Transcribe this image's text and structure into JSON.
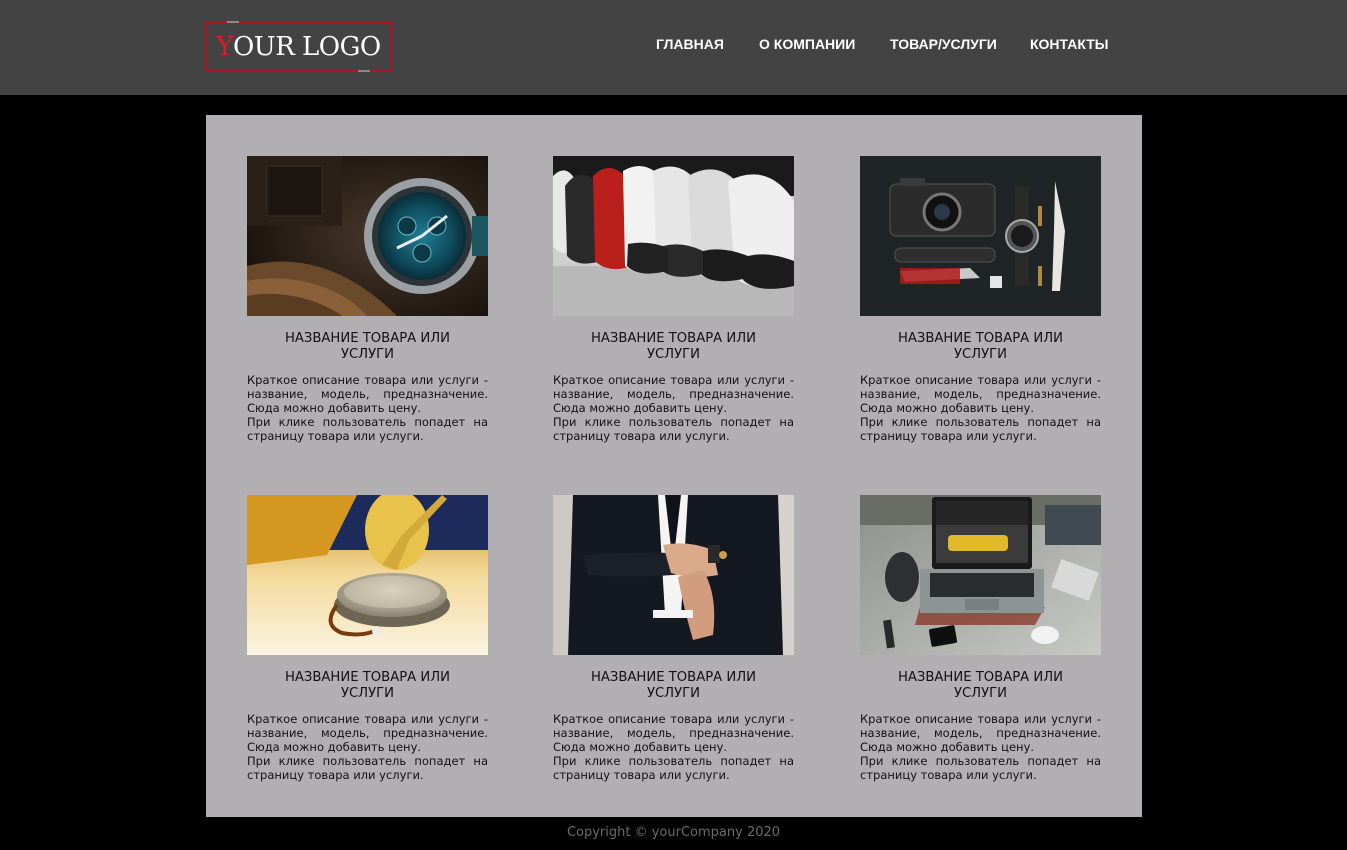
{
  "header": {
    "logo_first_letter": "Y",
    "logo_rest": "OUR LOGO",
    "nav": [
      {
        "label": "ГЛАВНАЯ"
      },
      {
        "label": "О КОМПАНИИ"
      },
      {
        "label": "ТОВАР/УСЛУГИ"
      },
      {
        "label": "КОНТАКТЫ"
      }
    ]
  },
  "products": [
    {
      "title": "НАЗВАНИЕ ТОВАРА ИЛИ УСЛУГИ",
      "desc1": "Краткое описание товара или услуги - название, модель, предназначение. Сюда можно добавить цену.",
      "desc2": "При клике пользователь попадет на страницу товара или услуги.",
      "image": "wristwatch-photo"
    },
    {
      "title": "НАЗВАНИЕ ТОВАРА ИЛИ УСЛУГИ",
      "desc1": "Краткое описание товара или услуги - название, модель, предназначение. Сюда можно добавить цену.",
      "desc2": "При клике пользователь попадет на страницу товара или услуги.",
      "image": "sneakers-photo"
    },
    {
      "title": "НАЗВАНИЕ ТОВАРА ИЛИ УСЛУГИ",
      "desc1": "Краткое описание товара или услуги - название, модель, предназначение. Сюда можно добавить цену.",
      "desc2": "При клике пользователь попадет на страницу товара или услуги.",
      "image": "camera-gear-flatlay-photo"
    },
    {
      "title": "НАЗВАНИЕ ТОВАРА ИЛИ УСЛУГИ",
      "desc1": "Краткое описание товара или услуги - название, модель, предназначение. Сюда можно добавить цену.",
      "desc2": "При клике пользователь попадет на страницу товара или услуги.",
      "image": "speaker-photo"
    },
    {
      "title": "НАЗВАНИЕ ТОВАРА ИЛИ УСЛУГИ",
      "desc1": "Краткое описание товара или услуги - название, модель, предназначение. Сюда можно добавить цену.",
      "desc2": "При клике пользователь попадет на страницу товара или услуги.",
      "image": "suit-cufflinks-photo"
    },
    {
      "title": "НАЗВАНИЕ ТОВАРА ИЛИ УСЛУГИ",
      "desc1": "Краткое описание товара или услуги - название, модель, предназначение. Сюда можно добавить цену.",
      "desc2": "При клике пользователь попадет на страницу товара или услуги.",
      "image": "laptop-desk-photo"
    }
  ],
  "footer": {
    "copyright": "Copyright © yourCompany 2020"
  },
  "colors": {
    "header_bg": "#434343",
    "page_bg": "#000000",
    "content_bg": "#b1afb2",
    "logo_accent": "#e21b22"
  }
}
